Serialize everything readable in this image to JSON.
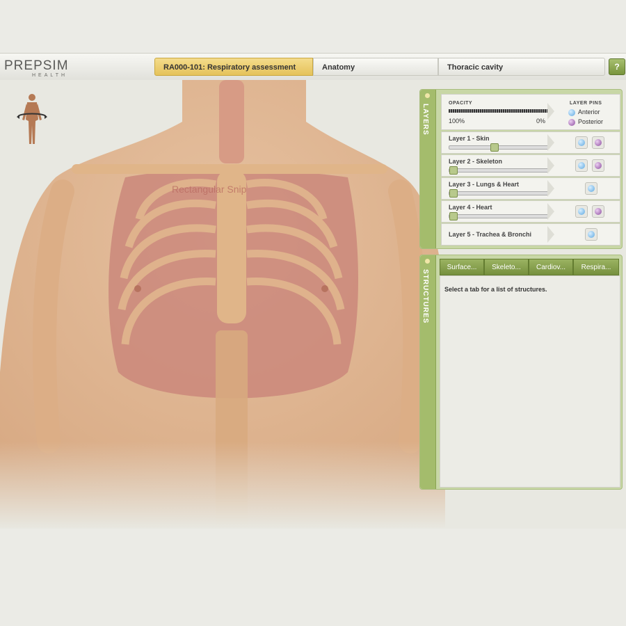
{
  "app": {
    "logo_main": "PREPSIM",
    "logo_sub": "HEALTH"
  },
  "breadcrumb": {
    "items": [
      "RA000-101: Respiratory assessment",
      "Anatomy",
      "Thoracic cavity"
    ]
  },
  "help_label": "?",
  "viewer": {
    "snip_label": "Rectangular Snip"
  },
  "layers": {
    "tab_label": "LAYERS",
    "opacity_label": "OPACITY",
    "opacity_min": "100%",
    "opacity_max": "0%",
    "pins_label": "LAYER PINS",
    "pin_anterior": "Anterior",
    "pin_posterior": "Posterior",
    "rows": [
      {
        "name": "Layer 1 - Skin",
        "value": 0.45
      },
      {
        "name": "Layer 2 - Skeleton",
        "value": 0.0
      },
      {
        "name": "Layer 3 - Lungs & Heart",
        "value": 0.0
      },
      {
        "name": "Layer 4 - Heart",
        "value": 0.0
      },
      {
        "name": "Layer 5 - Trachea & Bronchi",
        "value": null
      }
    ]
  },
  "structures": {
    "tab_label": "STRUCTURES",
    "tabs": [
      "Surface...",
      "Skeleto...",
      "Cardiov...",
      "Respira..."
    ],
    "message": "Select a tab for a list of structures."
  },
  "colors": {
    "panel_green": "#c8d7a6",
    "tab_green": "#8aa352",
    "crumb_gold": "#e5c25a",
    "pin_anterior": "#5ca7e0",
    "pin_posterior": "#8b4b9e"
  }
}
